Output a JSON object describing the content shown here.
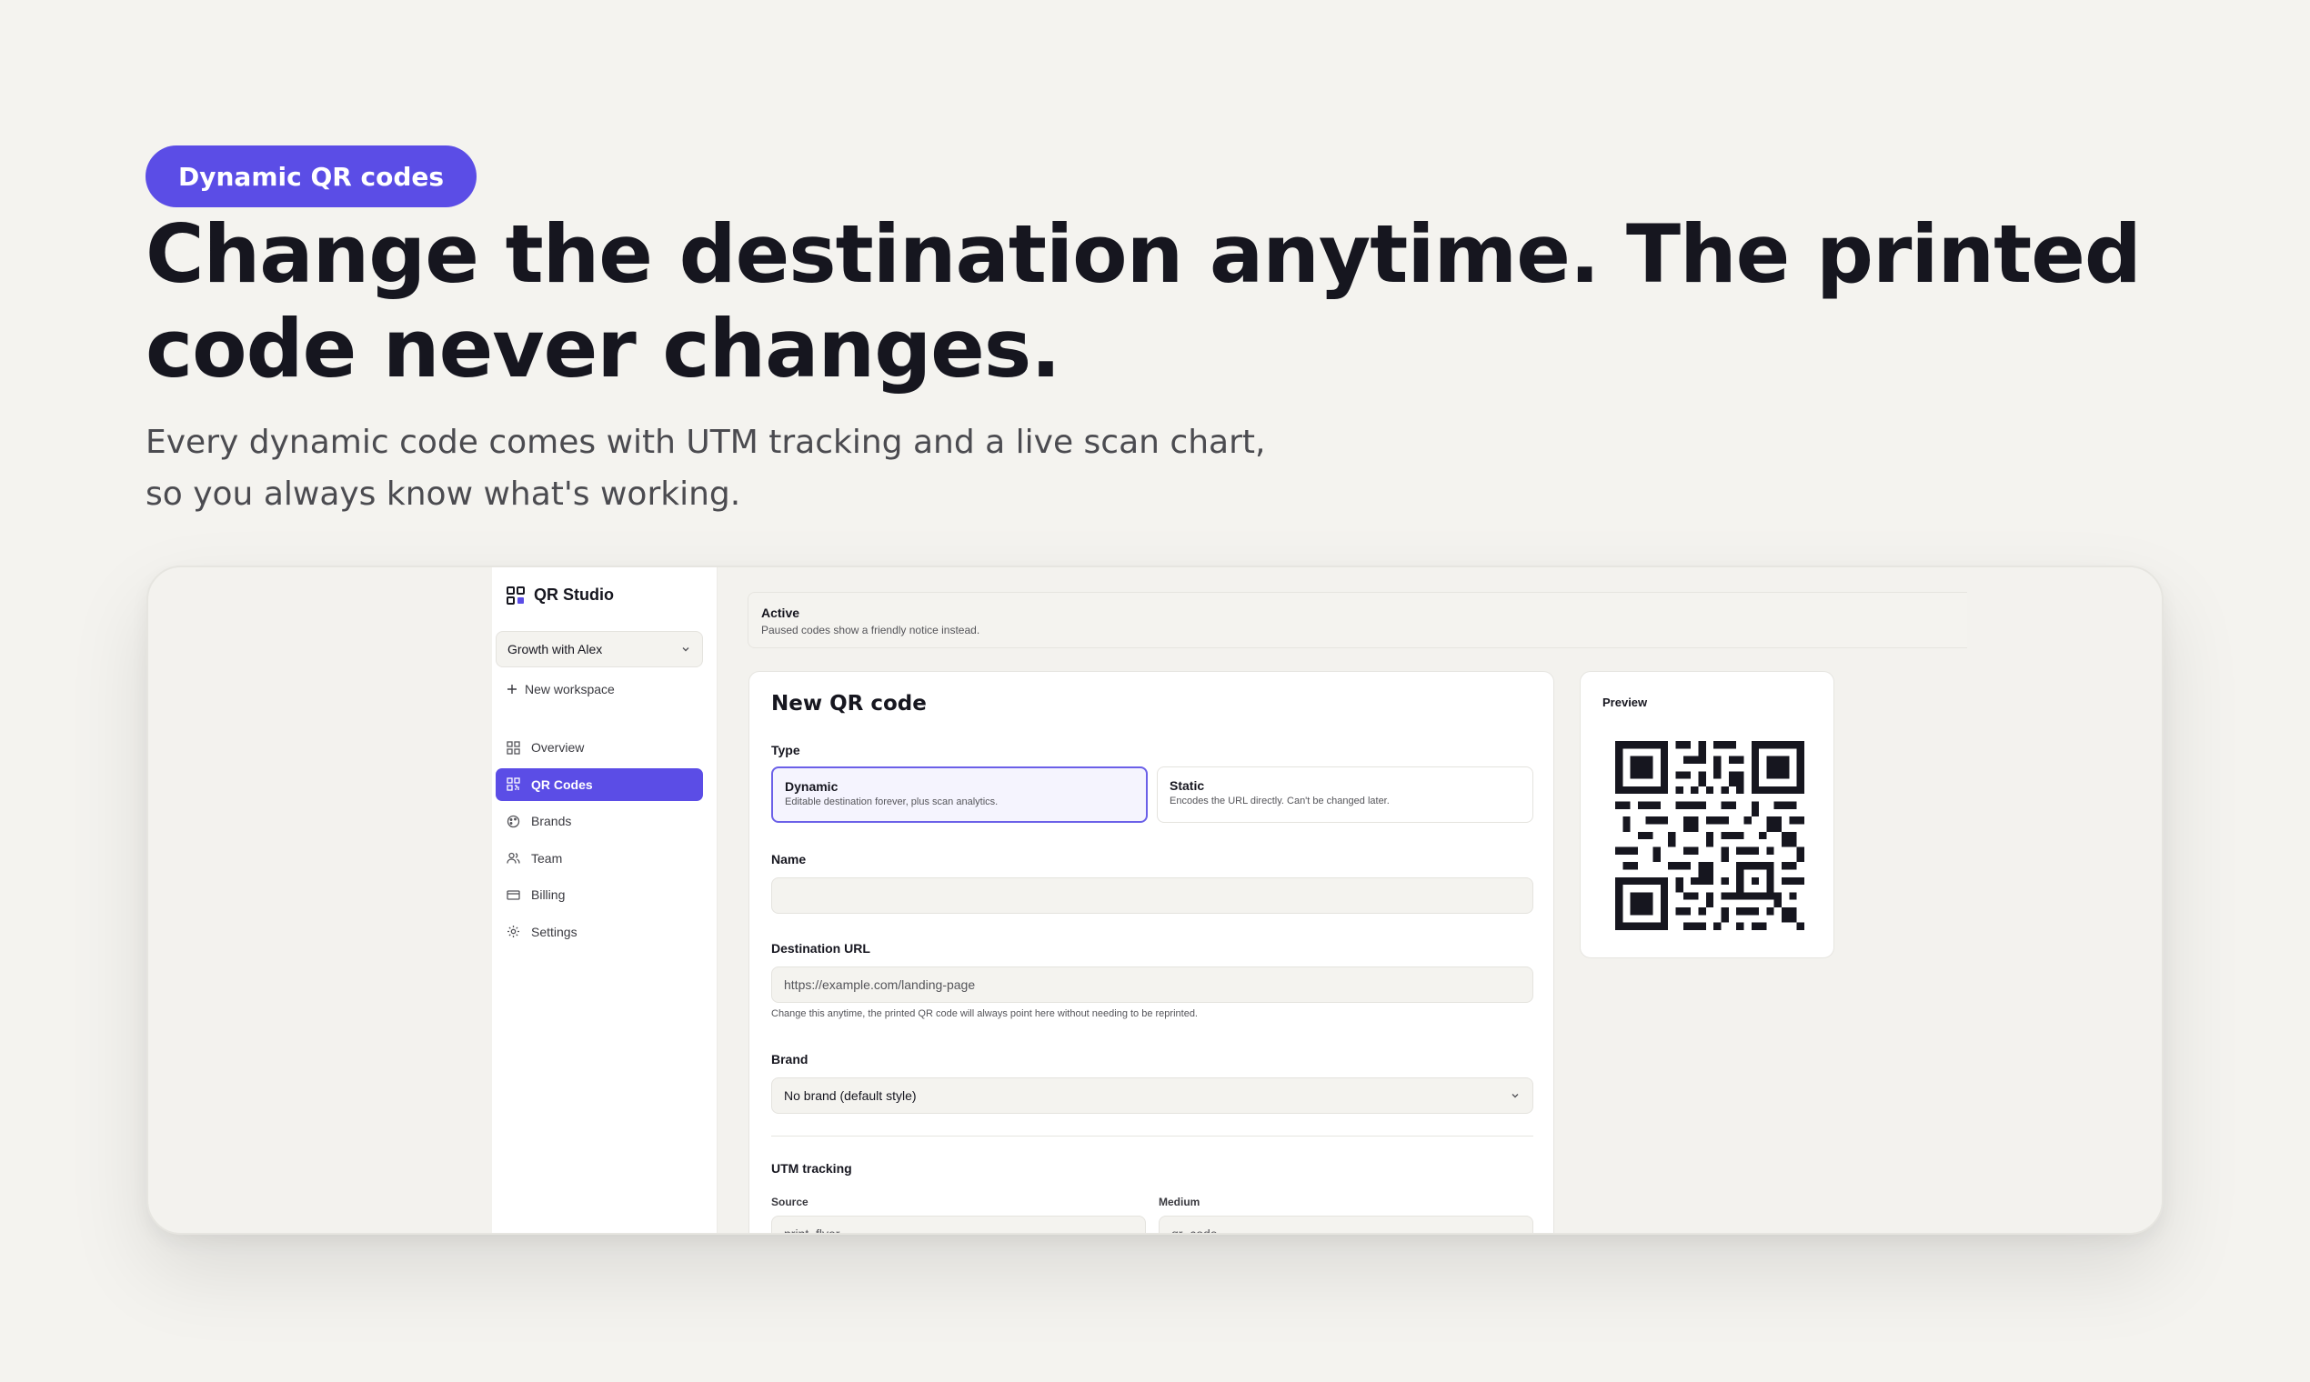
{
  "hero": {
    "badge": "Dynamic QR codes",
    "headline": "Change the destination anytime. The printed code never changes.",
    "subhead": "Every dynamic code comes with UTM tracking and a live scan chart, so you always know what's working."
  },
  "app": {
    "name": "QR Studio",
    "workspace": "Growth with Alex",
    "new_workspace": "New workspace",
    "nav": [
      {
        "label": "Overview",
        "icon": "grid-icon"
      },
      {
        "label": "QR Codes",
        "icon": "qr-icon",
        "active": true
      },
      {
        "label": "Brands",
        "icon": "palette-icon"
      },
      {
        "label": "Team",
        "icon": "users-icon"
      },
      {
        "label": "Billing",
        "icon": "card-icon"
      },
      {
        "label": "Settings",
        "icon": "gear-icon"
      }
    ]
  },
  "active": {
    "title": "Active",
    "desc": "Paused codes show a friendly notice instead.",
    "on": true
  },
  "form": {
    "title": "New QR code",
    "type_label": "Type",
    "types": [
      {
        "name": "Dynamic",
        "desc": "Editable destination forever, plus scan analytics."
      },
      {
        "name": "Static",
        "desc": "Encodes the URL directly. Can't be changed later."
      }
    ],
    "name_label": "Name",
    "name_value": "",
    "url_label": "Destination URL",
    "url_placeholder": "https://example.com/landing-page",
    "url_help": "Change this anytime, the printed QR code will always point here without needing to be reprinted.",
    "brand_label": "Brand",
    "brand_value": "No brand (default style)",
    "utm_label": "UTM tracking",
    "source_label": "Source",
    "source_value": "print_flyer",
    "medium_label": "Medium",
    "medium_value": "qr_code"
  },
  "preview": {
    "label": "Preview"
  },
  "colors": {
    "accent": "#5b4de6",
    "background": "#f4f3ef"
  }
}
